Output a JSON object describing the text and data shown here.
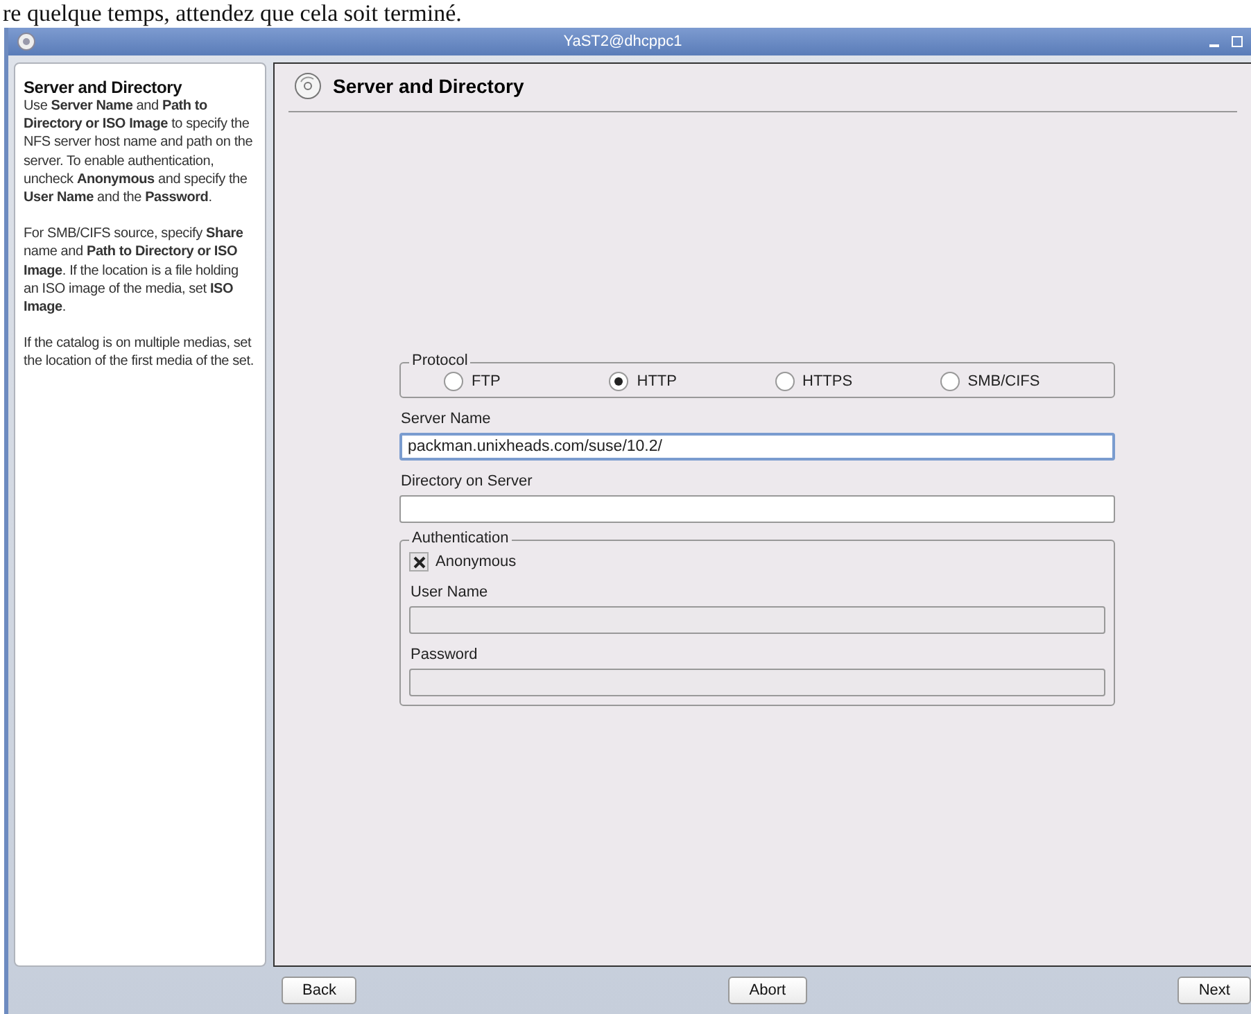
{
  "caption": "re quelque temps, attendez que cela soit terminé.",
  "window": {
    "title": "YaST2@dhcppc1"
  },
  "help": {
    "title": "Server and Directory",
    "paragraphs": [
      "Use **Server Name** and **Path to Directory or ISO Image** to specify the NFS server host name and path on the server. To enable authentication, uncheck **Anonymous** and specify the **User Name** and the **Password**.",
      "For SMB/CIFS source, specify **Share** name and **Path to Directory or ISO Image**. If the location is a file holding an ISO image of the media, set **ISO Image**.",
      "If the catalog is on multiple medias, set the location of the first media of the set."
    ]
  },
  "page": {
    "title": "Server and Directory"
  },
  "protocol": {
    "label": "Protocol",
    "options": [
      {
        "label": "FTP",
        "selected": false
      },
      {
        "label": "HTTP",
        "selected": true
      },
      {
        "label": "HTTPS",
        "selected": false
      },
      {
        "label": "SMB/CIFS",
        "selected": false
      }
    ]
  },
  "fields": [
    {
      "label": "Server Name",
      "value": "packman.unixheads.com/suse/10.2/",
      "focused": true
    },
    {
      "label": "Directory on Server",
      "focused": false
    }
  ],
  "authentication": {
    "label": "Authentication",
    "anonymous": {
      "label": "Anonymous",
      "checked": true
    },
    "fields": [
      {
        "label": "User Name",
        "disabled": true
      },
      {
        "label": "Password",
        "disabled": true
      }
    ]
  },
  "buttons": [
    {
      "label": "Back"
    },
    {
      "label": "Abort"
    },
    {
      "label": "Next"
    }
  ]
}
